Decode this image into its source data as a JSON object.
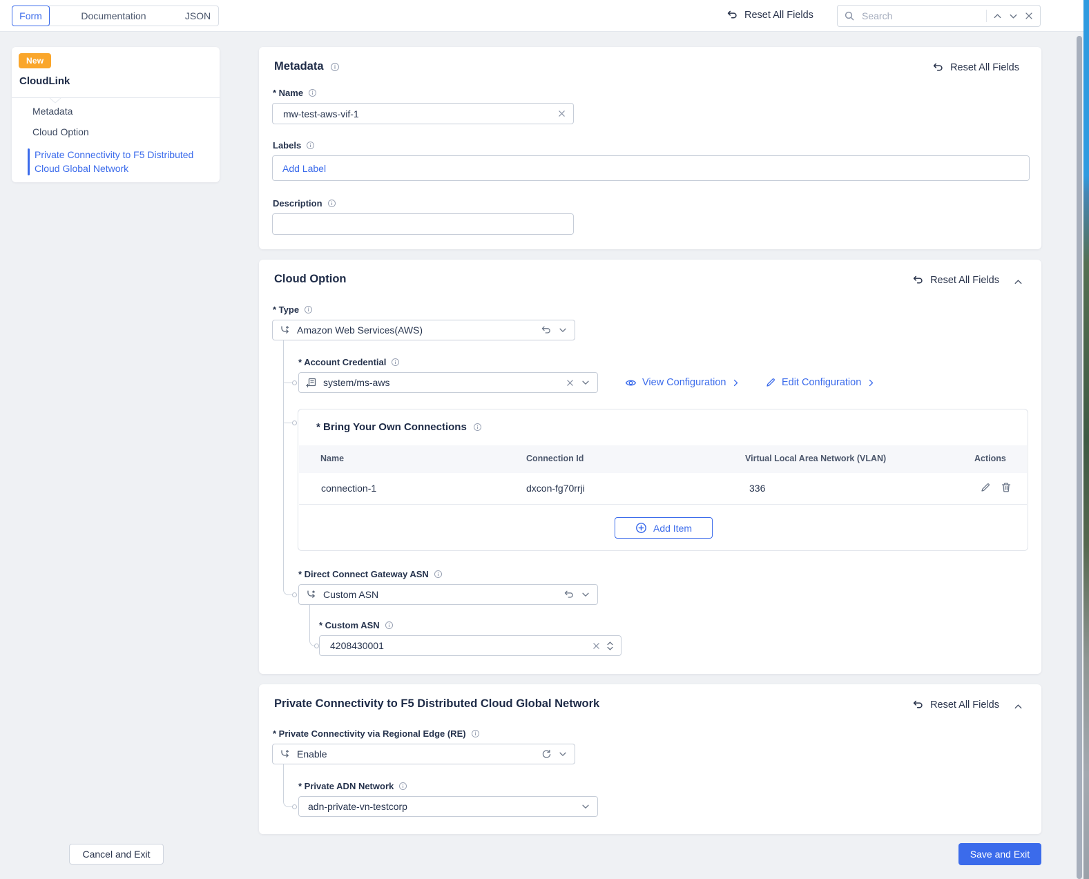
{
  "topbar": {
    "tabs": {
      "form": "Form",
      "documentation": "Documentation",
      "json": "JSON"
    },
    "reset_all_label": "Reset All Fields",
    "search_placeholder": "Search"
  },
  "sidebar": {
    "badge": "New",
    "title": "CloudLink",
    "items": [
      {
        "label": "Metadata",
        "active": false
      },
      {
        "label": "Cloud Option",
        "active": false
      },
      {
        "label": "Private Connectivity to F5 Distributed Cloud Global Network",
        "active": true
      }
    ]
  },
  "metadata": {
    "title": "Metadata",
    "reset_label": "Reset All Fields",
    "name_label": "* Name",
    "name_value": "mw-test-aws-vif-1",
    "labels_label": "Labels",
    "add_label_placeholder": "Add Label",
    "description_label": "Description",
    "description_value": ""
  },
  "cloud": {
    "title": "Cloud Option",
    "reset_label": "Reset All Fields",
    "type_label": "* Type",
    "type_value": "Amazon Web Services(AWS)",
    "account_credential_label": "* Account Credential",
    "account_credential_value": "system/ms-aws",
    "view_configuration_label": "View Configuration",
    "edit_configuration_label": "Edit Configuration",
    "byoc": {
      "title": "* Bring Your Own Connections",
      "columns": [
        "Name",
        "Connection Id",
        "Virtual Local Area Network (VLAN)",
        "Actions"
      ],
      "rows": [
        {
          "name": "connection-1",
          "connection_id": "dxcon-fg70rrji",
          "vlan": "336"
        }
      ],
      "add_item_label": "Add Item"
    },
    "dcg_asn_label": "* Direct Connect Gateway ASN",
    "dcg_asn_value": "Custom ASN",
    "custom_asn_label": "* Custom ASN",
    "custom_asn_value": "4208430001"
  },
  "private_connectivity": {
    "title": "Private Connectivity to F5 Distributed Cloud Global Network",
    "reset_label": "Reset All Fields",
    "regional_edge_label": "* Private Connectivity via Regional Edge (RE)",
    "regional_edge_value": "Enable",
    "adn_network_label": "* Private ADN Network",
    "adn_network_value": "adn-private-vn-testcorp"
  },
  "footer": {
    "cancel_label": "Cancel and Exit",
    "save_label": "Save and Exit"
  },
  "colors": {
    "accent": "#3B6BEB",
    "navy": "#26334D",
    "badge_orange": "#FAA62B",
    "background": "#EFF1F4"
  }
}
